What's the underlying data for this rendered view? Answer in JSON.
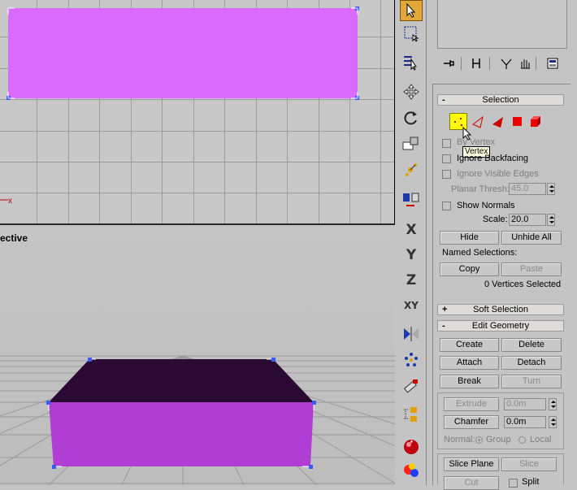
{
  "viewports": {
    "perspective_label": "ective"
  },
  "toolbar": {
    "tools": [
      {
        "name": "select-tool",
        "active": true
      },
      {
        "name": "region-select-tool"
      },
      {
        "name": "select-by-name-tool"
      },
      {
        "name": "move-tool"
      },
      {
        "name": "rotate-tool"
      },
      {
        "name": "scale-tool"
      },
      {
        "name": "pivot-tool"
      },
      {
        "name": "link-tool"
      },
      {
        "name": "x-axis-constraint",
        "glyph": "X"
      },
      {
        "name": "y-axis-constraint",
        "glyph": "Y"
      },
      {
        "name": "z-axis-constraint",
        "glyph": "Z"
      },
      {
        "name": "xy-plane-constraint",
        "glyph": "XY"
      },
      {
        "name": "mirror-tool"
      },
      {
        "name": "array-tool"
      },
      {
        "name": "align-tool"
      },
      {
        "name": "layers-tool"
      },
      {
        "name": "material-editor"
      },
      {
        "name": "render-tool"
      }
    ]
  },
  "command_panel": {
    "selection": {
      "header_sign": "-",
      "header": "Selection",
      "tooltip": "Vertex",
      "by_vertex": "By Vertex",
      "ignore_backfacing": "Ignore Backfacing",
      "ignore_visible_edges": "Ignore Visible Edges",
      "planar_thresh_label": "Planar Thresh:",
      "planar_thresh_value": "45.0",
      "show_normals": "Show Normals",
      "scale_label": "Scale:",
      "scale_value": "20.0",
      "hide": "Hide",
      "unhide_all": "Unhide All",
      "named_selections": "Named Selections:",
      "copy": "Copy",
      "paste": "Paste",
      "status": "0 Vertices Selected"
    },
    "soft_selection": {
      "header_sign": "+",
      "header": "Soft Selection"
    },
    "edit_geometry": {
      "header_sign": "-",
      "header": "Edit Geometry",
      "create": "Create",
      "delete": "Delete",
      "attach": "Attach",
      "detach": "Detach",
      "break": "Break",
      "turn": "Turn",
      "extrude": "Extrude",
      "extrude_value": "0.0m",
      "chamfer": "Chamfer",
      "chamfer_value": "0.0m",
      "normal": "Normal:",
      "group": "Group",
      "local": "Local",
      "slice_plane": "Slice Plane",
      "slice": "Slice",
      "cut": "Cut",
      "split": "Split"
    }
  },
  "colors": {
    "object_magenta": "#d96bff",
    "box_side": "#b03dd4",
    "box_top": "#2a0a33",
    "vertex_blue": "#3a5bff",
    "active_tool": "#e2a63a",
    "vertex_button": "#ffff00"
  }
}
